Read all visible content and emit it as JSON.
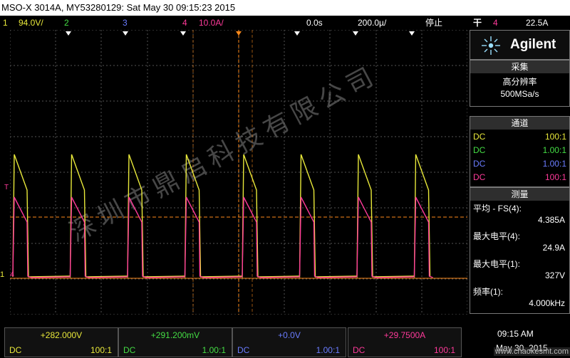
{
  "title_bar": {
    "text": "MSO-X 3014A, MY53280129: Sat May 30 09:15:23 2015"
  },
  "status": {
    "ch1_num": "1",
    "ch1_scale": "94.0V/",
    "ch2_num": "2",
    "ch3_num": "3",
    "ch4_num": "4",
    "ch4_scale": "10.0A/",
    "delay": "0.0s",
    "timebase": "200.0µ/",
    "run_state": "停止",
    "trig_icon": "rising-edge-icon",
    "trig_src": "4",
    "trig_level": "22.5A"
  },
  "colors": {
    "ch1": "#e8e83a",
    "ch2": "#44dd44",
    "ch3": "#6a7cff",
    "ch4": "#ff3a9a",
    "trigger": "#ff8a1a"
  },
  "sidebar": {
    "brand": "Agilent",
    "acq_header": "采集",
    "acq_mode": "高分辨率",
    "acq_rate": "500MSa/s",
    "ch_header": "通道",
    "channels": [
      {
        "coupling": "DC",
        "probe": "100:1"
      },
      {
        "coupling": "DC",
        "probe": "1.00:1"
      },
      {
        "coupling": "DC",
        "probe": "1.00:1"
      },
      {
        "coupling": "DC",
        "probe": "100:1"
      }
    ],
    "meas_header": "测量",
    "measurements": [
      {
        "label": "平均 - FS(4):",
        "value": "4.385A"
      },
      {
        "label": "最大电平(4):",
        "value": "24.9A"
      },
      {
        "label": "最大电平(1):",
        "value": "327V"
      },
      {
        "label": "频率(1):",
        "value": "4.000kHz"
      }
    ]
  },
  "bottom": {
    "channels": [
      {
        "offset": "+282.000V",
        "coupling": "DC",
        "probe": "100:1"
      },
      {
        "offset": "+291.200mV",
        "coupling": "DC",
        "probe": "1.00:1"
      },
      {
        "offset": "+0.0V",
        "coupling": "DC",
        "probe": "1.00:1"
      },
      {
        "offset": "+29.7500A",
        "coupling": "DC",
        "probe": "100:1"
      }
    ],
    "time": "09:15 AM",
    "date": "May 30, 2015"
  },
  "marks": {
    "t_marker": "T",
    "ch1_marker": "1",
    "ch4_marker": "4"
  },
  "watermark": {
    "text": "深圳市鼎启科技有限公司",
    "site": "www.chaokesmt.com"
  }
}
